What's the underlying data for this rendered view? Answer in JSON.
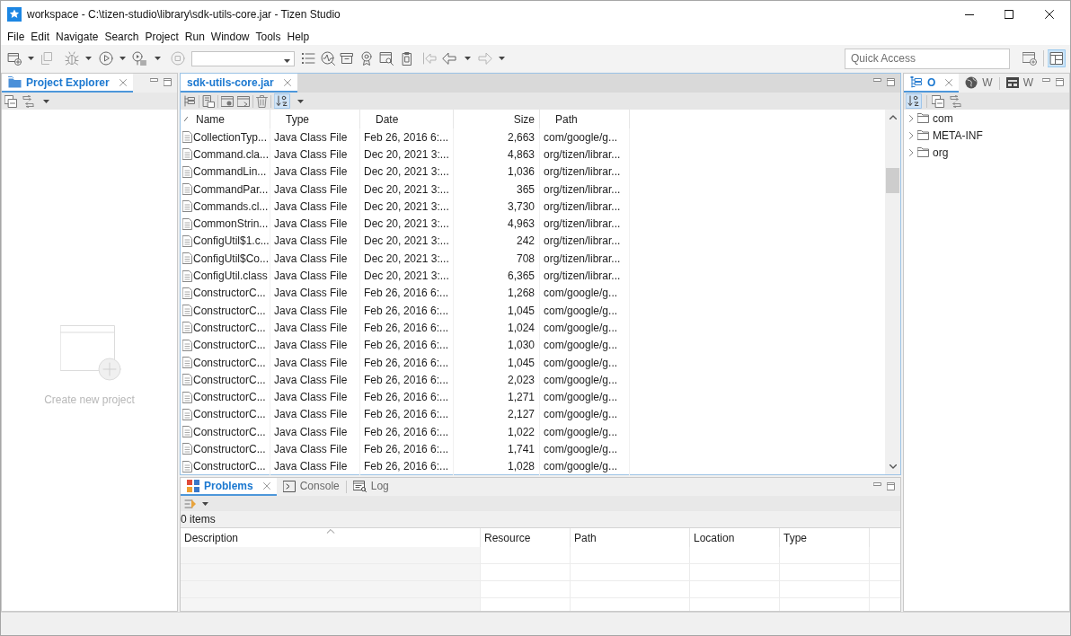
{
  "window": {
    "title": "workspace - C:\\tizen-studio\\library\\sdk-utils-core.jar - Tizen Studio"
  },
  "menu": [
    {
      "label": "File"
    },
    {
      "label": "Edit"
    },
    {
      "label": "Navigate"
    },
    {
      "label": "Search"
    },
    {
      "label": "Project"
    },
    {
      "label": "Run"
    },
    {
      "label": "Window"
    },
    {
      "label": "Tools"
    },
    {
      "label": "Help"
    }
  ],
  "toolbar": {
    "quick_access": {
      "placeholder": "Quick Access"
    }
  },
  "left_panel": {
    "tabs": [
      {
        "label": "Project Explorer",
        "selected": true
      }
    ],
    "empty_state": {
      "link": "Create new project"
    }
  },
  "editor": {
    "tabs": [
      {
        "label": "sdk-utils-core.jar",
        "selected": true
      }
    ],
    "columns": [
      {
        "label": "Name",
        "sorted": true
      },
      {
        "label": "Type",
        "sorted": false
      },
      {
        "label": "Date",
        "sorted": false
      },
      {
        "label": "Size",
        "sorted": false
      },
      {
        "label": "Path",
        "sorted": false
      }
    ],
    "rows": [
      [
        "CollectionTyp...",
        "Java Class File",
        "Feb 26, 2016 6:...",
        "2,663",
        "com/google/g..."
      ],
      [
        "Command.cla...",
        "Java Class File",
        "Dec 20, 2021 3:...",
        "4,863",
        "org/tizen/librar..."
      ],
      [
        "CommandLin...",
        "Java Class File",
        "Dec 20, 2021 3:...",
        "1,036",
        "org/tizen/librar..."
      ],
      [
        "CommandPar...",
        "Java Class File",
        "Dec 20, 2021 3:...",
        "365",
        "org/tizen/librar..."
      ],
      [
        "Commands.cl...",
        "Java Class File",
        "Dec 20, 2021 3:...",
        "3,730",
        "org/tizen/librar..."
      ],
      [
        "CommonStrin...",
        "Java Class File",
        "Dec 20, 2021 3:...",
        "4,963",
        "org/tizen/librar..."
      ],
      [
        "ConfigUtil$1.c...",
        "Java Class File",
        "Dec 20, 2021 3:...",
        "242",
        "org/tizen/librar..."
      ],
      [
        "ConfigUtil$Co...",
        "Java Class File",
        "Dec 20, 2021 3:...",
        "708",
        "org/tizen/librar..."
      ],
      [
        "ConfigUtil.class",
        "Java Class File",
        "Dec 20, 2021 3:...",
        "6,365",
        "org/tizen/librar..."
      ],
      [
        "ConstructorC...",
        "Java Class File",
        "Feb 26, 2016 6:...",
        "1,268",
        "com/google/g..."
      ],
      [
        "ConstructorC...",
        "Java Class File",
        "Feb 26, 2016 6:...",
        "1,045",
        "com/google/g..."
      ],
      [
        "ConstructorC...",
        "Java Class File",
        "Feb 26, 2016 6:...",
        "1,024",
        "com/google/g..."
      ],
      [
        "ConstructorC...",
        "Java Class File",
        "Feb 26, 2016 6:...",
        "1,030",
        "com/google/g..."
      ],
      [
        "ConstructorC...",
        "Java Class File",
        "Feb 26, 2016 6:...",
        "1,045",
        "com/google/g..."
      ],
      [
        "ConstructorC...",
        "Java Class File",
        "Feb 26, 2016 6:...",
        "2,023",
        "com/google/g..."
      ],
      [
        "ConstructorC...",
        "Java Class File",
        "Feb 26, 2016 6:...",
        "1,271",
        "com/google/g..."
      ],
      [
        "ConstructorC...",
        "Java Class File",
        "Feb 26, 2016 6:...",
        "2,127",
        "com/google/g..."
      ],
      [
        "ConstructorC...",
        "Java Class File",
        "Feb 26, 2016 6:...",
        "1,022",
        "com/google/g..."
      ],
      [
        "ConstructorC...",
        "Java Class File",
        "Feb 26, 2016 6:...",
        "1,741",
        "com/google/g..."
      ],
      [
        "ConstructorC...",
        "Java Class File",
        "Feb 26, 2016 6:...",
        "1,028",
        "com/google/g..."
      ]
    ]
  },
  "bottom_panel": {
    "tabs": [
      {
        "label": "Problems",
        "selected": true
      },
      {
        "label": "Console",
        "selected": false
      },
      {
        "label": "Log",
        "selected": false
      }
    ],
    "count": "0 items",
    "columns": [
      {
        "label": "Description",
        "sorted": true
      },
      {
        "label": "Resource",
        "sorted": false
      },
      {
        "label": "Path",
        "sorted": false
      },
      {
        "label": "Location",
        "sorted": false
      },
      {
        "label": "Type",
        "sorted": false
      }
    ]
  },
  "right_panel": {
    "tabs": [
      {
        "label": "O",
        "selected": true
      },
      {
        "label": "W",
        "selected": false
      },
      {
        "label": "W",
        "selected": false
      }
    ],
    "tree": [
      {
        "label": "com",
        "expanded": false
      },
      {
        "label": "META-INF",
        "expanded": false
      },
      {
        "label": "org",
        "expanded": false
      }
    ]
  }
}
